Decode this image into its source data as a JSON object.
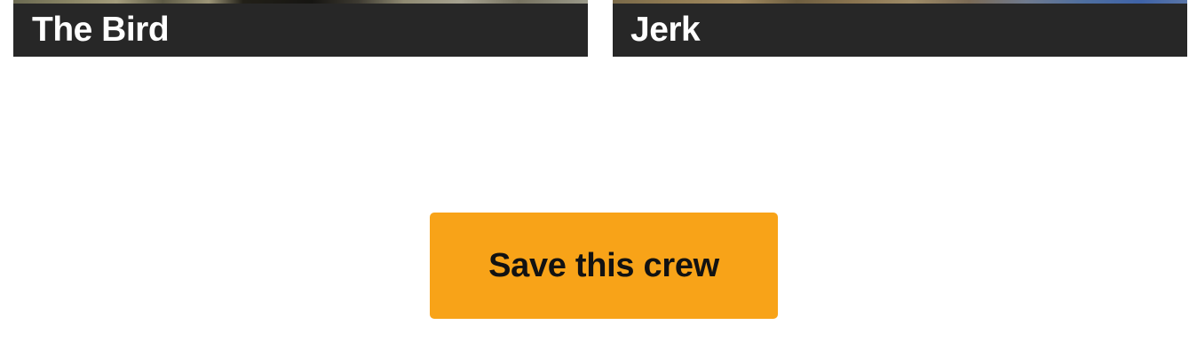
{
  "cards": [
    {
      "title": "The Bird"
    },
    {
      "title": "Jerk"
    }
  ],
  "actions": {
    "save_label": "Save this crew"
  },
  "colors": {
    "card_caption_bg": "#272727",
    "card_caption_text": "#ffffff",
    "save_button_bg": "#f8a318",
    "save_button_text": "#121212",
    "page_bg": "#ffffff"
  }
}
